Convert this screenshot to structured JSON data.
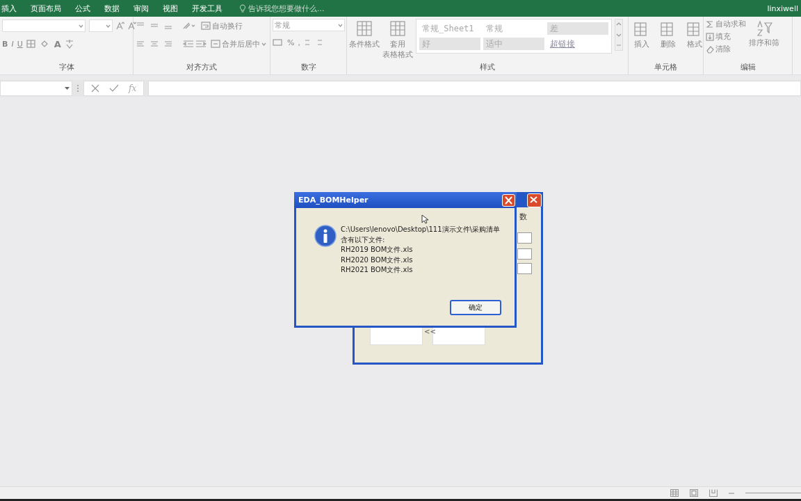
{
  "menu_tabs": [
    {
      "label": "插入",
      "selected": false
    },
    {
      "label": "页面布局",
      "selected": false
    },
    {
      "label": "公式",
      "selected": false
    },
    {
      "label": "数据",
      "selected": false
    },
    {
      "label": "审阅",
      "selected": false
    },
    {
      "label": "视图",
      "selected": false
    },
    {
      "label": "开发工具",
      "selected": false
    }
  ],
  "tell_me": {
    "placeholder": "告诉我您想要做什么..."
  },
  "user": "linxiwell",
  "ribbon": {
    "groups": [
      {
        "kind": "font",
        "label": "字体",
        "format_buttons": [
          "B",
          "I",
          "U"
        ],
        "font_color": "A"
      },
      {
        "kind": "alignment",
        "label": "对齐方式",
        "wrap_text": "自动换行",
        "merge_center": "合并后居中"
      },
      {
        "kind": "number",
        "label": "数字",
        "format": "常规",
        "percent": "%",
        "comma": ","
      },
      {
        "kind": "styles",
        "label": "样式",
        "buttons": [
          {
            "lines": [
              "条件格式"
            ]
          },
          {
            "lines": [
              "套用",
              "表格格式"
            ]
          }
        ],
        "gallery": [
          {
            "label": "常规_Sheet1",
            "kind": "normal"
          },
          {
            "label": "常规",
            "kind": "normal"
          },
          {
            "label": "差",
            "kind": "bad"
          },
          {
            "label": "好",
            "kind": "good"
          },
          {
            "label": "适中",
            "kind": "neutral"
          },
          {
            "label": "超链接",
            "kind": "hyperlink"
          }
        ]
      },
      {
        "kind": "cells",
        "label": "单元格",
        "buttons": [
          "插入",
          "删除",
          "格式"
        ]
      },
      {
        "kind": "editing",
        "label": "编辑",
        "items": [
          "自动求和",
          "填充",
          "清除"
        ],
        "sort": "排序和筛"
      }
    ]
  },
  "formula_bar": {
    "function_label": "fx"
  },
  "back_dialog": {
    "label": "数",
    "toggle": "<<"
  },
  "dialog": {
    "title": "EDA_BOMHelper",
    "lines": [
      "C:\\Users\\lenovo\\Desktop\\111演示文件\\采购清单",
      "含有以下文件:",
      "RH2019 BOM文件.xls",
      "RH2020 BOM文件.xls",
      "RH2021 BOM文件.xls"
    ],
    "ok_button": "确定"
  }
}
